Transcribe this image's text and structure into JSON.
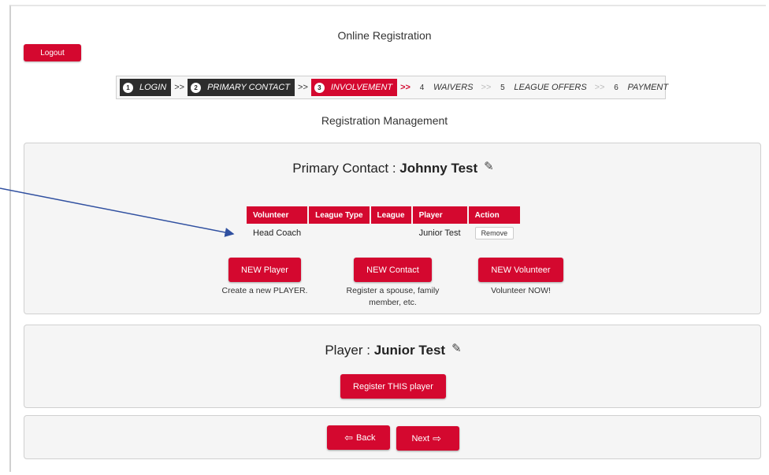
{
  "header": {
    "title": "Online Registration",
    "logout_label": "Logout",
    "sub_title": "Registration Management"
  },
  "steps": [
    {
      "num": "1",
      "label": "LOGIN"
    },
    {
      "num": "2",
      "label": "PRIMARY CONTACT"
    },
    {
      "num": "3",
      "label": "INVOLVEMENT"
    },
    {
      "num": "4",
      "label": "WAIVERS"
    },
    {
      "num": "5",
      "label": "LEAGUE OFFERS"
    },
    {
      "num": "6",
      "label": "PAYMENT"
    }
  ],
  "step_separator": ">>",
  "primary_contact": {
    "label": "Primary Contact : ",
    "name": "Johnny Test",
    "table": {
      "headers": [
        "Volunteer",
        "League Type",
        "League",
        "Player",
        "Action"
      ],
      "rows": [
        {
          "volunteer": "Head Coach",
          "league_type": "",
          "league": "",
          "player": "Junior Test",
          "action": "Remove"
        }
      ]
    },
    "actions": {
      "new_player": {
        "label": "NEW Player",
        "caption": "Create a new PLAYER."
      },
      "new_contact": {
        "label": "NEW Contact",
        "caption": "Register a spouse, family member, etc."
      },
      "new_volunteer": {
        "label": "NEW Volunteer",
        "caption": "Volunteer NOW!"
      }
    }
  },
  "player": {
    "label": "Player : ",
    "name": "Junior Test",
    "register_label": "Register THIS player"
  },
  "nav": {
    "back_label": "Back",
    "next_label": "Next"
  },
  "colors": {
    "accent": "#d4082f",
    "dark_step": "#2d2d2d",
    "annotation_arrow": "#3050a0"
  }
}
